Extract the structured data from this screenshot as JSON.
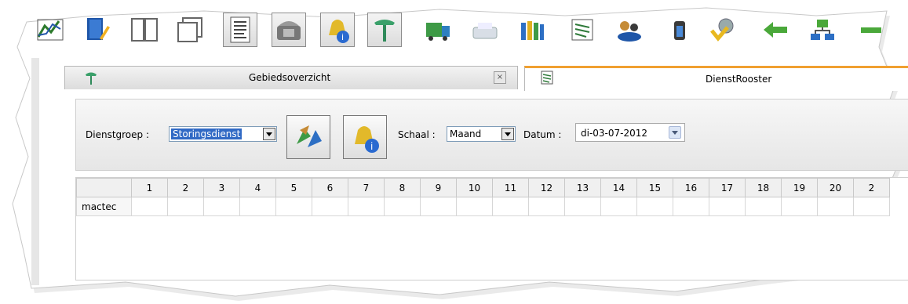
{
  "toolbar": {
    "buttons": [
      {
        "icon": "line-chart-icon"
      },
      {
        "icon": "book-edit-icon"
      },
      {
        "icon": "open-book-icon"
      },
      {
        "icon": "windows-icon"
      },
      {
        "icon": "document-list-icon"
      },
      {
        "icon": "phone-icon"
      },
      {
        "icon": "bell-info-icon"
      },
      {
        "icon": "pin-icon"
      },
      {
        "icon": "truck-icon"
      },
      {
        "icon": "scanner-icon"
      },
      {
        "icon": "bottles-icon"
      },
      {
        "icon": "schedule-icon"
      },
      {
        "icon": "users-icon"
      },
      {
        "icon": "battery-icon"
      },
      {
        "icon": "settings-check-icon"
      },
      {
        "icon": "back-arrow-icon"
      },
      {
        "icon": "network-icon"
      },
      {
        "icon": "minus-icon"
      }
    ]
  },
  "tabs": [
    {
      "label": "Gebiedsoverzicht",
      "active": false
    },
    {
      "label": "DienstRooster",
      "active": true
    }
  ],
  "filters": {
    "dienstgroep_label": "Dienstgroep :",
    "dienstgroep_value": "Storingsdienst",
    "schaal_label": "Schaal :",
    "schaal_value": "Maand",
    "datum_label": "Datum :",
    "datum_value": "di-03-07-2012"
  },
  "grid": {
    "days": [
      "1",
      "2",
      "3",
      "4",
      "5",
      "6",
      "7",
      "8",
      "9",
      "10",
      "11",
      "12",
      "13",
      "14",
      "15",
      "16",
      "17",
      "18",
      "19",
      "20",
      "2"
    ],
    "rows": [
      {
        "name": "mactec"
      }
    ]
  },
  "colors": {
    "accent_tab": "#f0a030",
    "selection": "#316ac5"
  }
}
